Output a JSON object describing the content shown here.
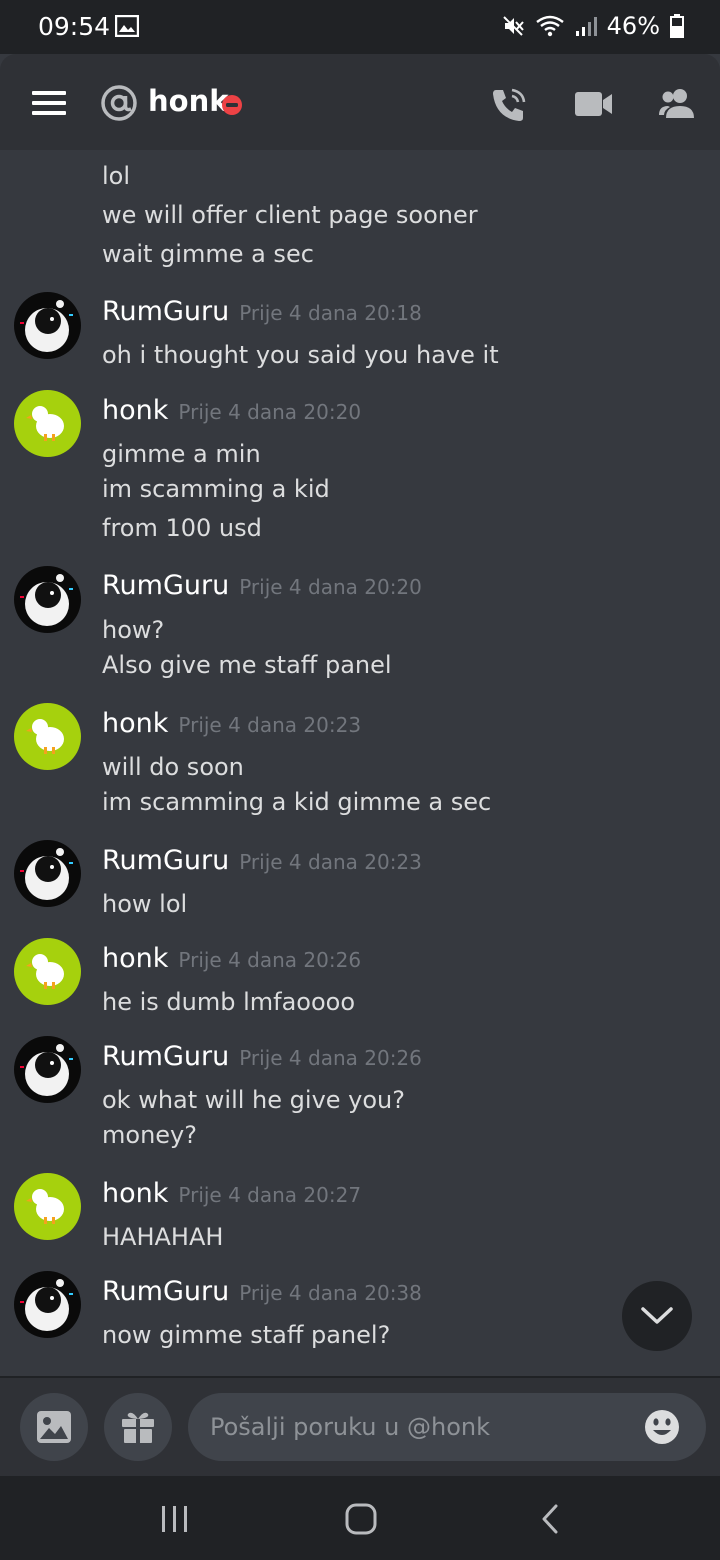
{
  "status_bar": {
    "time": "09:54",
    "battery": "46%"
  },
  "header": {
    "channel_prefix_icon": "at-icon",
    "dm_name": "honk",
    "presence": "do-not-disturb"
  },
  "messages": {
    "partial_top": "lol",
    "continued": [
      "we will offer client page sooner",
      "wait gimme a sec"
    ],
    "groups": [
      {
        "author": "RumGuru",
        "timestamp": "Prije 4 dana 20:18",
        "lines": [
          "oh i thought you said you have it"
        ]
      },
      {
        "author": "honk",
        "timestamp": "Prije 4 dana 20:20",
        "lines": [
          "gimme a min",
          "im scamming a kid",
          "from 100 usd"
        ]
      },
      {
        "author": "RumGuru",
        "timestamp": "Prije 4 dana 20:20",
        "lines": [
          "how?",
          "Also give me staff panel"
        ]
      },
      {
        "author": "honk",
        "timestamp": "Prije 4 dana 20:23",
        "lines": [
          "will do soon",
          "im scamming a kid gimme a sec"
        ]
      },
      {
        "author": "RumGuru",
        "timestamp": "Prije 4 dana 20:23",
        "lines": [
          "how lol"
        ]
      },
      {
        "author": "honk",
        "timestamp": "Prije 4 dana 20:26",
        "lines": [
          "he is dumb lmfaoooo"
        ]
      },
      {
        "author": "RumGuru",
        "timestamp": "Prije 4 dana 20:26",
        "lines": [
          "ok what will he give you?",
          "money?"
        ]
      },
      {
        "author": "honk",
        "timestamp": "Prije 4 dana 20:27",
        "lines": [
          "HAHAHAH"
        ]
      },
      {
        "author": "RumGuru",
        "timestamp": "Prije 4 dana 20:38",
        "lines": [
          "now gimme staff panel?"
        ]
      }
    ]
  },
  "composer": {
    "placeholder": "Pošalji poruku u @honk"
  },
  "colors": {
    "background": "#36393f",
    "header": "#2f3136",
    "honk_avatar": "#a6d10d",
    "dnd": "#ed4245",
    "timestamp": "#72767d"
  }
}
